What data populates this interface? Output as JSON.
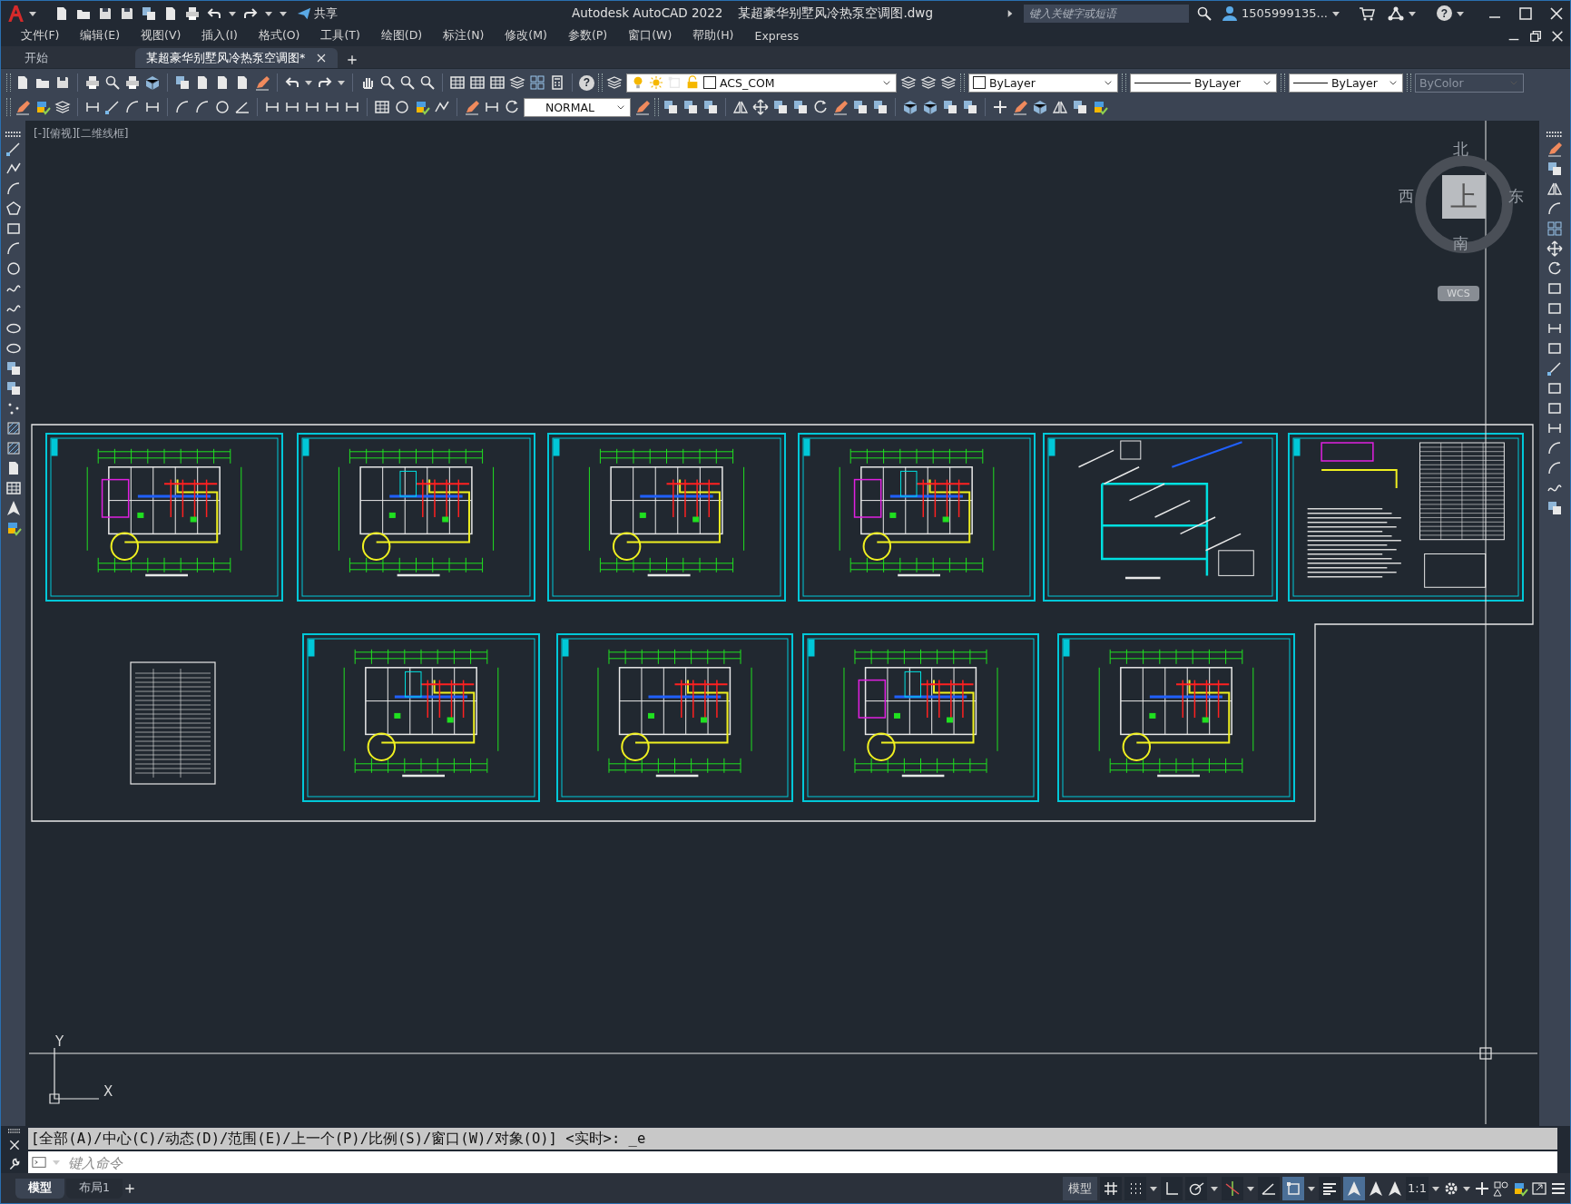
{
  "title_bar": {
    "share_label": "共享",
    "title": "Autodesk AutoCAD 2022    某超豪华别墅风冷热泵空调图.dwg",
    "search": {
      "placeholder": "键入关键字或短语"
    },
    "user": "1505999135...",
    "help_glyph": "?"
  },
  "menu": [
    "文件(F)",
    "编辑(E)",
    "视图(V)",
    "插入(I)",
    "格式(O)",
    "工具(T)",
    "绘图(D)",
    "标注(N)",
    "修改(M)",
    "参数(P)",
    "窗口(W)",
    "帮助(H)",
    "Express"
  ],
  "file_tabs": [
    {
      "label": "开始",
      "selected": false
    },
    {
      "label": "某超豪华别墅风冷热泵空调图*",
      "selected": true
    }
  ],
  "layer_control": {
    "value": "ACS_COM"
  },
  "text_style": {
    "value": "NORMAL"
  },
  "properties": [
    {
      "kind": "color",
      "value": "ByLayer",
      "disabled": false
    },
    {
      "kind": "linetype",
      "value": "ByLayer",
      "disabled": false
    },
    {
      "kind": "lineweight",
      "value": "ByLayer",
      "disabled": false
    },
    {
      "kind": "plotstyle",
      "value": "ByColor",
      "disabled": true
    }
  ],
  "viewport": {
    "label": "[-][俯视][二维线框]"
  },
  "viewcube": {
    "north": "北",
    "south": "南",
    "east": "东",
    "west": "西",
    "face": "上",
    "coordinate_system": "WCS"
  },
  "ucs": {
    "y_label": "Y",
    "x_label": "X"
  },
  "command_line": {
    "history": "[全部(A)/中心(C)/动态(D)/范围(E)/上一个(P)/比例(S)/窗口(W)/对象(O)] <实时>: _e",
    "placeholder": "键入命令"
  },
  "layout_tabs": [
    {
      "label": "模型",
      "selected": true
    },
    {
      "label": "布局1",
      "selected": false
    }
  ],
  "status_bar": {
    "space": "模型",
    "scale": "1:1",
    "toggles": [
      {
        "on": false
      },
      {
        "on": false
      },
      {
        "on": false
      },
      {
        "on": false
      },
      {
        "on": false
      },
      {
        "on": false
      },
      {
        "on": true
      },
      {
        "on": false
      },
      {
        "on": true
      }
    ]
  }
}
